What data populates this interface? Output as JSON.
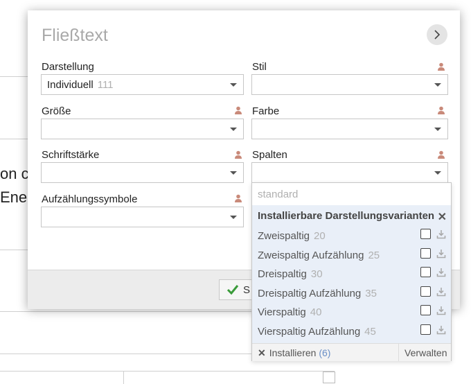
{
  "background": {
    "text_line_1": "on c",
    "text_line_2": "Ener"
  },
  "dialog": {
    "title": "Fließtext",
    "next_icon": "chevron-right-icon",
    "fields": {
      "darstellung": {
        "label": "Darstellung",
        "value": "Individuell",
        "count": "111"
      },
      "stil": {
        "label": "Stil",
        "value": ""
      },
      "groesse": {
        "label": "Größe",
        "value": ""
      },
      "farbe": {
        "label": "Farbe",
        "value": ""
      },
      "schriftstaerke": {
        "label": "Schriftstärke",
        "value": ""
      },
      "spalten": {
        "label": "Spalten",
        "value": ""
      },
      "aufzaehlungssymbole": {
        "label": "Aufzählungssymbole",
        "value": ""
      }
    },
    "footer": {
      "save_label": "S"
    }
  },
  "dropdown": {
    "standard_option": "standard",
    "section_title": "Installierbare Darstellungsvarianten",
    "items": [
      {
        "label": "Zweispaltig",
        "count": "20"
      },
      {
        "label": "Zweispaltig Aufzählung",
        "count": "25"
      },
      {
        "label": "Dreispaltig",
        "count": "30"
      },
      {
        "label": "Dreispaltig Aufzählung",
        "count": "35"
      },
      {
        "label": "Vierspaltig",
        "count": "40"
      },
      {
        "label": "Vierspaltig Aufzählung",
        "count": "45"
      }
    ],
    "install_label": "Installieren",
    "install_count": "(6)",
    "manage_label": "Verwalten"
  },
  "colors": {
    "accent_green": "#3a9b3a",
    "section_bg": "#e9eff8",
    "person_icon": "#c98a7a"
  }
}
